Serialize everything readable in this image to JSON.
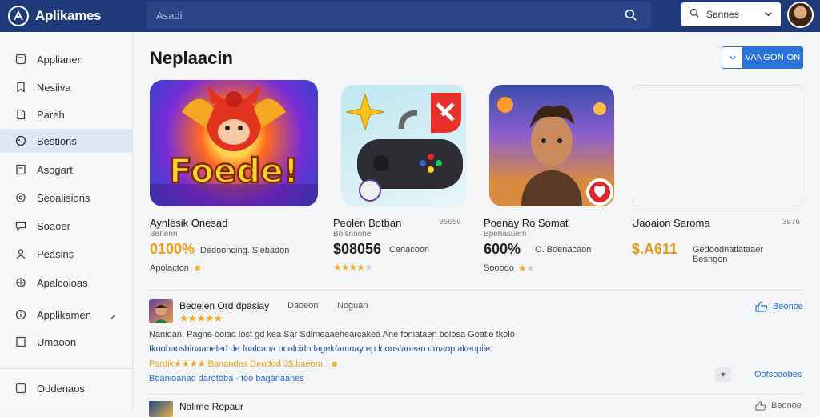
{
  "app": {
    "name": "Aplikames",
    "search_placeholder": "Asadi",
    "filter_label": "Sannes",
    "accent": "#1e3a78",
    "link_color": "#2a6fd6"
  },
  "sidebar": {
    "items": [
      {
        "label": "Applianen",
        "icon": "app-icon"
      },
      {
        "label": "Nesiiva",
        "icon": "bookmark-icon"
      },
      {
        "label": "Pareh",
        "icon": "document-icon"
      },
      {
        "label": "Bestions",
        "icon": "tag-icon",
        "active": true
      },
      {
        "label": "Asogart",
        "icon": "document-icon"
      },
      {
        "label": "Seoalisions",
        "icon": "settings-icon"
      },
      {
        "label": "Soaoer",
        "icon": "chat-icon"
      },
      {
        "label": "Peasins",
        "icon": "person-icon"
      },
      {
        "label": "Apalcoioas",
        "icon": "settings-icon"
      },
      {
        "label": "Applikamen",
        "icon": "info-icon"
      },
      {
        "label": "Umaoon",
        "icon": "document-icon"
      }
    ],
    "footer_label": "Oddenaos"
  },
  "main": {
    "title": "Neplaacin",
    "top_action_label": "VANGON ON"
  },
  "cards": [
    {
      "art_text": "Foede!",
      "name": "Aynlesik Onesad",
      "size": "",
      "sub": "Banenn",
      "price": "0100%",
      "price_color": "#f29a10",
      "desc": "Dedooncing. Slebadon",
      "foot": "Apolacton"
    },
    {
      "name": "Peolen Botban",
      "size": "95656",
      "sub": "Bolsnaone",
      "price": "$08056",
      "price_color": "#1a1a1a",
      "desc": "Cenacoon",
      "foot": "",
      "stars": 4
    },
    {
      "name": "Poenay Ro Somat",
      "size": "",
      "sub": "Bpenasuem",
      "price": "600%",
      "price_color": "#1a1a1a",
      "desc": "O. Boenacaon",
      "foot": "Sooodo"
    },
    {
      "name": "Uaoaion Saroma",
      "size": "3976",
      "sub": "",
      "price": "$.A611",
      "price_color": "#e79a1a",
      "desc": "Gedoodnatlataaer Besngon",
      "foot": ""
    }
  ],
  "reviews": [
    {
      "title": "Bedelen Ord dpasiay",
      "meta1": "Daoeon",
      "meta2": "Noguan",
      "stars": 5,
      "body": "Nanidan. Pagne ooiad lost gd kea  Sar Sdlmeaaehearcakea Ane  foniataen bolosa Goatie tkolo",
      "link": "Ikoobaoshinaaneled de foalcana ooolcidh lagekfamnay ep loonslanean dmaop akeopiie.",
      "rating_text": "Pardik★★★★ Banandes  Deodod 3$.baeom.",
      "tags": "Boanioanao darotoba  -  foo baganaanes",
      "action": "Beonoe",
      "more": "Oofsoaobes"
    },
    {
      "title": "Nalime Ropaur",
      "action": "Beonoe"
    }
  ]
}
